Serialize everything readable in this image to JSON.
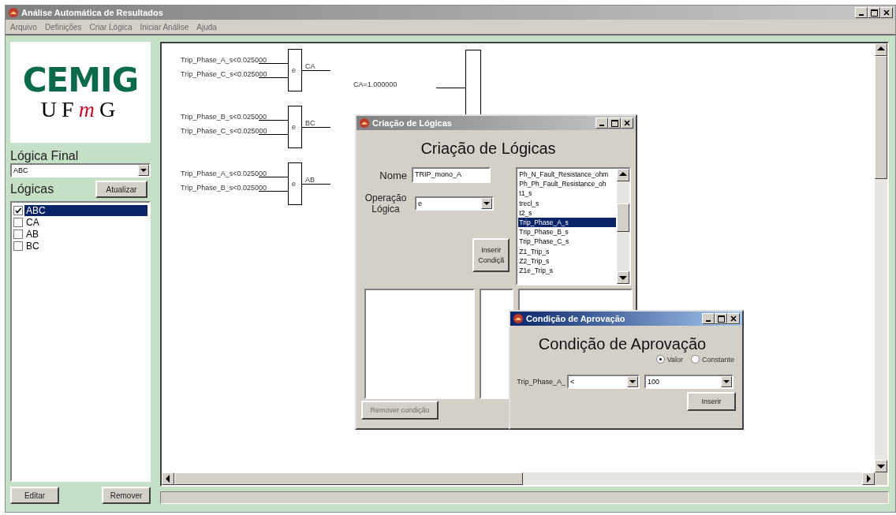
{
  "main_window": {
    "title": "Análise Automática de Resultados",
    "active": false
  },
  "menu": [
    "Arquivo",
    "Definições",
    "Criar Lógica",
    "Iniciar Análise",
    "Ajuda"
  ],
  "logo": {
    "top": "CEMIG",
    "bottom_left": "UF",
    "bottom_mark": "m",
    "bottom_right": "G"
  },
  "left_panel": {
    "final_logic_label": "Lógica Final",
    "final_logic_value": "ABC",
    "logics_label": "Lógicas",
    "refresh_button": "Atualizar",
    "logics": [
      {
        "label": "ABC",
        "checked": true,
        "selected": true
      },
      {
        "label": "CA",
        "checked": false,
        "selected": false
      },
      {
        "label": "AB",
        "checked": false,
        "selected": false
      },
      {
        "label": "BC",
        "checked": false,
        "selected": false
      }
    ],
    "buttons": [
      "Editar",
      "Remover"
    ]
  },
  "diagram": {
    "gates": [
      {
        "inputs": [
          "Trip_Phase_A_s<0.025000",
          "Trip_Phase_C_s<0.025000"
        ],
        "operator": "e",
        "output": "CA"
      },
      {
        "inputs": [
          "Trip_Phase_B_s<0.025000",
          "Trip_Phase_C_s<0.025000"
        ],
        "operator": "e",
        "output": "BC"
      },
      {
        "inputs": [
          "Trip_Phase_A_s<0.025000",
          "Trip_Phase_B_s<0.025000"
        ],
        "operator": "e",
        "output": "AB"
      }
    ],
    "result_input": "CA=1.000000"
  },
  "logic_dialog": {
    "title": "Criação de Lógicas",
    "active": false,
    "heading": "Criação de Lógicas",
    "name_label": "Nome",
    "name_value": "TRIP_mono_A",
    "operation_label": "Operação Lógica",
    "operation_value": "e",
    "insert_button": "Inserir Condiçã",
    "variables": [
      {
        "label": "Ph_N_Fault_Resistance_ohm",
        "selected": false
      },
      {
        "label": "Ph_Ph_Fault_Resistance_oh",
        "selected": false
      },
      {
        "label": "t1_s",
        "selected": false
      },
      {
        "label": "trecl_s",
        "selected": false
      },
      {
        "label": "t2_s",
        "selected": false
      },
      {
        "label": "Trip_Phase_A_s",
        "selected": true
      },
      {
        "label": "Trip_Phase_B_s",
        "selected": false
      },
      {
        "label": "Trip_Phase_C_s",
        "selected": false
      },
      {
        "label": "Z1_Trip_s",
        "selected": false
      },
      {
        "label": "Z2_Trip_s",
        "selected": false
      },
      {
        "label": "Z1e_Trip_s",
        "selected": false
      }
    ],
    "remove_button": "Remover condição",
    "remove_disabled": true
  },
  "approval_dialog": {
    "title": "Condição de Aprovação",
    "active": true,
    "heading": "Condição de Aprovação",
    "modes": [
      {
        "label": "Valor",
        "selected": true
      },
      {
        "label": "Constante",
        "selected": false
      }
    ],
    "variable_label": "Trip_Phase_A_",
    "operator_value": "<",
    "value": "100",
    "insert_button": "Inserir"
  }
}
